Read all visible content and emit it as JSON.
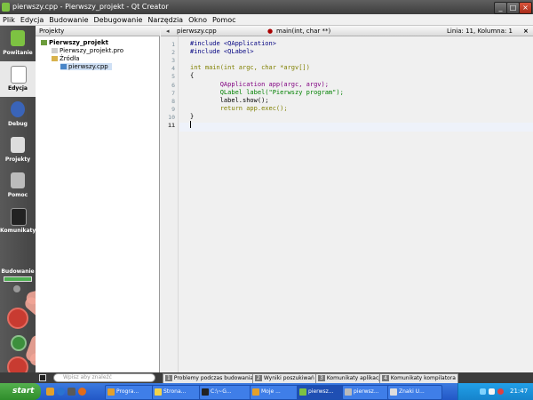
{
  "window": {
    "title": "pierwszy.cpp - Pierwszy_projekt - Qt Creator",
    "controls": [
      "_",
      "□",
      "×"
    ]
  },
  "menu": [
    "Plik",
    "Edycja",
    "Budowanie",
    "Debugowanie",
    "Narzędzia",
    "Okno",
    "Pomoc"
  ],
  "modes": [
    {
      "label": "Powitanie",
      "icon": "qt-logo-icon"
    },
    {
      "label": "Edycja",
      "icon": "edit-document-icon",
      "active": true
    },
    {
      "label": "Debug",
      "icon": "debug-bug-icon"
    },
    {
      "label": "Projekty",
      "icon": "projects-icon"
    },
    {
      "label": "Pomoc",
      "icon": "help-book-icon"
    },
    {
      "label": "Komunikaty",
      "icon": "output-monitor-icon"
    }
  ],
  "build_section": {
    "label": "Budowanie"
  },
  "projects_pane": {
    "selector": "Projekty",
    "tree": [
      {
        "label": "Pierwszy_projekt",
        "level": 0,
        "bold": true
      },
      {
        "label": "Pierwszy_projekt.pro",
        "level": 1
      },
      {
        "label": "Źródła",
        "level": 1
      },
      {
        "label": "pierwszy.cpp",
        "level": 2,
        "selected": true
      }
    ]
  },
  "editor": {
    "file": "pierwszy.cpp",
    "symbol": "main(int, char **)",
    "status": "Linia: 11, Kolumna: 1",
    "lines": [
      "#include <QApplication>",
      "#include <QLabel>",
      "",
      "int main(int argc, char *argv[])",
      "{",
      "        QApplication app(argc, argv);",
      "        QLabel label(\"Pierwszy program\");",
      "        label.show();",
      "        return app.exec();",
      "}",
      ""
    ],
    "line_numbers": [
      "1",
      "2",
      "3",
      "4",
      "5",
      "6",
      "7",
      "8",
      "9",
      "10",
      "11"
    ],
    "current_line": 11
  },
  "output_tabs": [
    {
      "n": "1",
      "label": "Problemy podczas budowania"
    },
    {
      "n": "2",
      "label": "Wyniki poszukiwań"
    },
    {
      "n": "3",
      "label": "Komunikaty aplikacji"
    },
    {
      "n": "4",
      "label": "Komunikaty kompilatora"
    }
  ],
  "locator": {
    "placeholder": "Wpisz aby znaleźć"
  },
  "taskbar": {
    "start": "start",
    "tasks": [
      "Progra...",
      "Strona...",
      "C:\\~G...",
      "Moje ...",
      "pierwsz...",
      "pierwsz...",
      "Znaki U..."
    ],
    "clock": "21:47"
  },
  "colors": {
    "accent_run": "#c83b31",
    "arrow": "#f2a597",
    "keyword": "#808000",
    "string": "#008000",
    "type": "#800080"
  }
}
